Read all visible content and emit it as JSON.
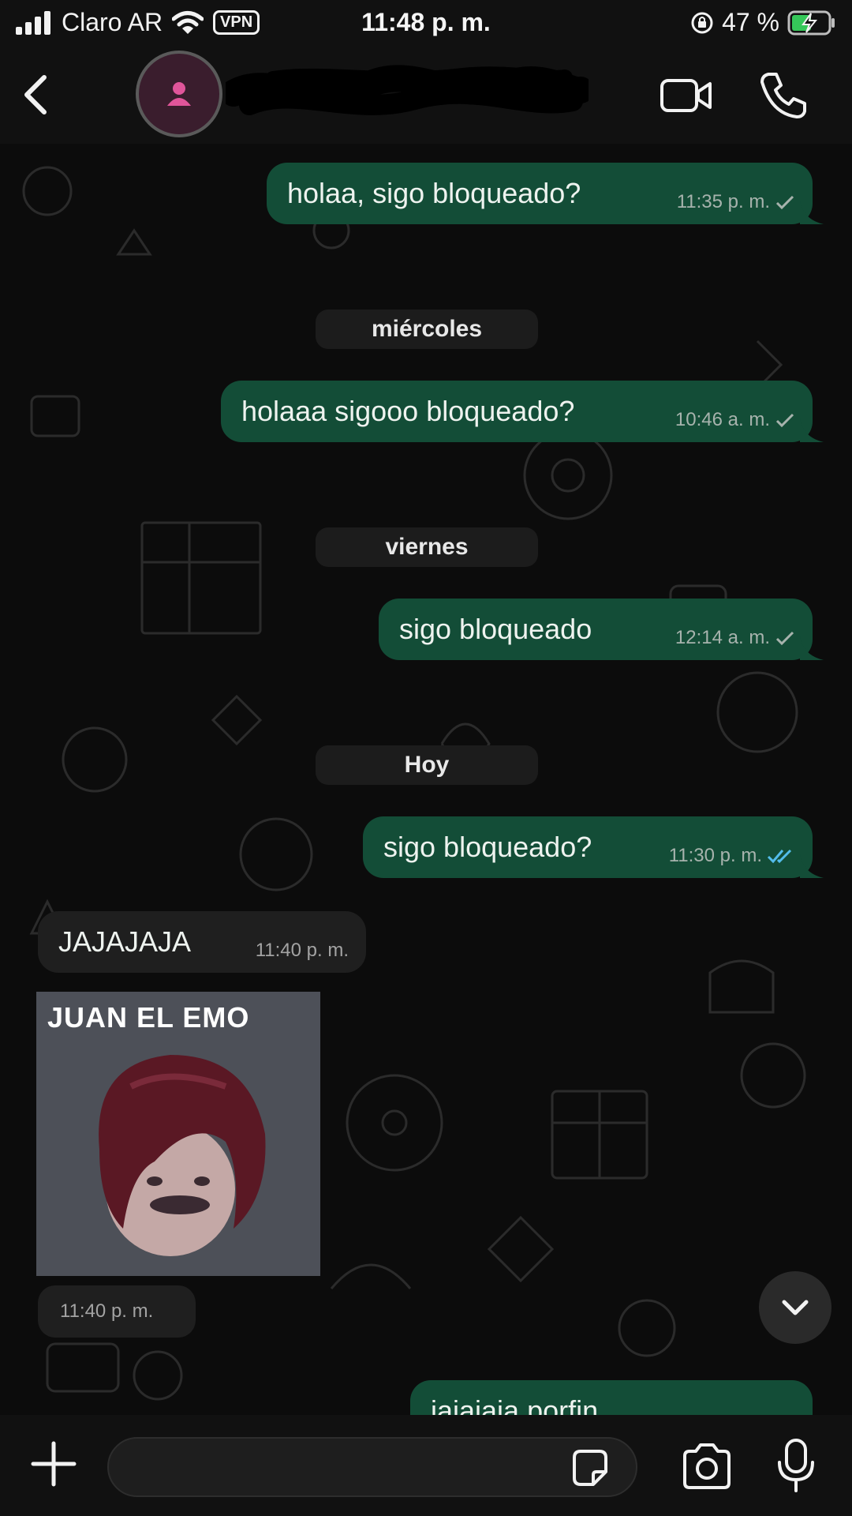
{
  "status_bar": {
    "carrier": "Claro AR",
    "vpn": "VPN",
    "time": "11:48 p. m.",
    "battery_percent": "47 %"
  },
  "header": {
    "contact_name": "",
    "icons": [
      "back-chevron-icon",
      "avatar-person-icon",
      "video-call-icon",
      "phone-icon"
    ]
  },
  "messages": [
    {
      "type": "out",
      "text": "holaa, sigo bloqueado?",
      "time": "11:35 p. m.",
      "status": "sent"
    },
    {
      "type": "date",
      "text": "miércoles"
    },
    {
      "type": "out",
      "text": "holaaa sigooo bloqueado?",
      "time": "10:46 a. m.",
      "status": "sent"
    },
    {
      "type": "date",
      "text": "viernes"
    },
    {
      "type": "out",
      "text": "sigo bloqueado",
      "time": "12:14 a. m.",
      "status": "sent"
    },
    {
      "type": "date",
      "text": "Hoy"
    },
    {
      "type": "out",
      "text": "sigo bloqueado?",
      "time": "11:30 p. m.",
      "status": "read"
    },
    {
      "type": "in",
      "text": "JAJAJAJA",
      "time": "11:40 p. m."
    },
    {
      "type": "sticker",
      "caption": "JUAN EL EMO",
      "time": "11:40 p. m."
    },
    {
      "type": "out",
      "text": "jajajaja porfin",
      "time": "",
      "status": "read",
      "partial": true
    }
  ],
  "composer": {
    "input_placeholder": "",
    "icons": [
      "plus-icon",
      "sticker-icon",
      "camera-icon",
      "microphone-icon"
    ]
  },
  "colors": {
    "outgoing_bubble": "#134d37",
    "incoming_bubble": "#1f1f1f",
    "read_tick": "#53bdeb",
    "background": "#0c0c0c"
  }
}
